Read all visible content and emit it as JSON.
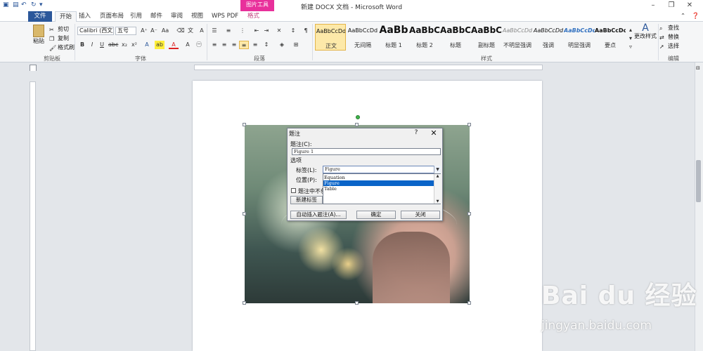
{
  "window": {
    "title": "新建 DOCX 文档 - Microsoft Word",
    "picture_tools": "图片工具",
    "minimize": "–",
    "restore": "❐",
    "close": "✕"
  },
  "tabs": [
    "文件",
    "开始",
    "插入",
    "页面布局",
    "引用",
    "邮件",
    "审阅",
    "视图",
    "WPS PDF",
    "格式"
  ],
  "ribbon": {
    "clipboard": {
      "paste": "粘贴",
      "cut": "剪切",
      "copy": "复制",
      "format_painter": "格式刷",
      "label": "剪贴板"
    },
    "font": {
      "name": "Calibri (西文正",
      "size": "五号",
      "label": "字体"
    },
    "paragraph": {
      "label": "段落"
    },
    "styles": {
      "label": "样式",
      "items": [
        {
          "sample": "AaBbCcDd",
          "name": "正文"
        },
        {
          "sample": "AaBbCcDd",
          "name": "无间隔"
        },
        {
          "sample": "AaBb",
          "name": "标题 1"
        },
        {
          "sample": "AaBbC",
          "name": "标题 2"
        },
        {
          "sample": "AaBbC",
          "name": "标题"
        },
        {
          "sample": "AaBbC",
          "name": "副标题"
        },
        {
          "sample": "AaBbCcDd",
          "name": "不明显强调"
        },
        {
          "sample": "AaBbCcDd",
          "name": "强调"
        },
        {
          "sample": "AaBbCcDc",
          "name": "明显强调"
        },
        {
          "sample": "AaBbCcDc",
          "name": "要点"
        }
      ],
      "change": "更改样式"
    },
    "editing": {
      "find": "查找",
      "replace": "替换",
      "select": "选择",
      "label": "编辑"
    }
  },
  "dialog": {
    "title": "题注",
    "help": "?",
    "close": "✕",
    "caption_label": "题注(C):",
    "caption_value": "Figure 1",
    "options_label": "选项",
    "label_label": "标签(L):",
    "label_value": "Figure",
    "position_label": "位置(P):",
    "exclude_label": "题注中不包",
    "options": [
      "Equation",
      "Figure",
      "Table"
    ],
    "new_label": "新建标签",
    "autocaption": "自动插入题注(A)...",
    "ok": "确定",
    "cancel": "关闭"
  },
  "watermark": {
    "brand": "Bai du 经验",
    "url": "jingyan.baidu.com"
  }
}
